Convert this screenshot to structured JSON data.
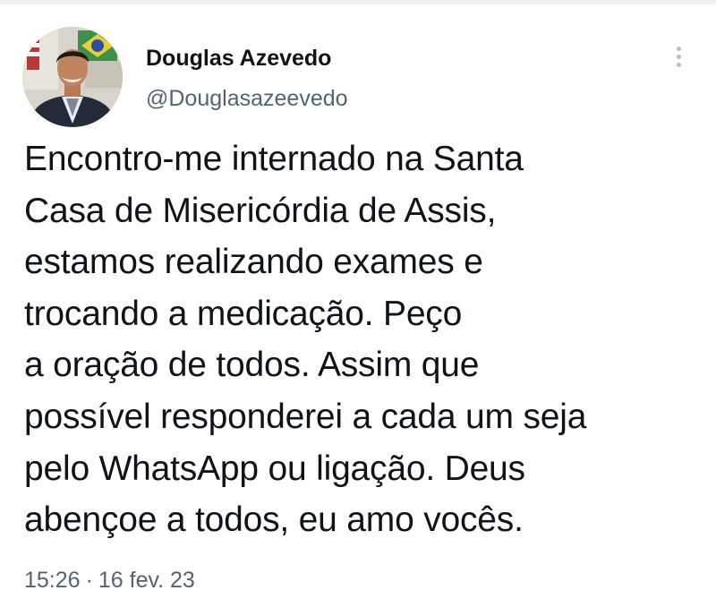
{
  "author": {
    "name": "Douglas Azevedo",
    "handle": "@Douglasazeevedo",
    "avatar_icon": "profile-photo"
  },
  "menu_icon": "more-vertical-icon",
  "tweet": {
    "lines": [
      "Encontro-me internado na Santa",
      "Casa de Misericórdia de Assis,",
      "estamos realizando exames e",
      "trocando a medicação. Peço",
      "a oração de todos. Assim que",
      "possível responderei a cada um seja",
      "pelo WhatsApp ou ligação. Deus",
      "abençoe a todos, eu amo vocês."
    ]
  },
  "meta": {
    "time": "15:26",
    "separator": "·",
    "date": "16 fev. 23"
  },
  "colors": {
    "text": "#0f1419",
    "secondary": "#536471",
    "background": "#ffffff"
  }
}
